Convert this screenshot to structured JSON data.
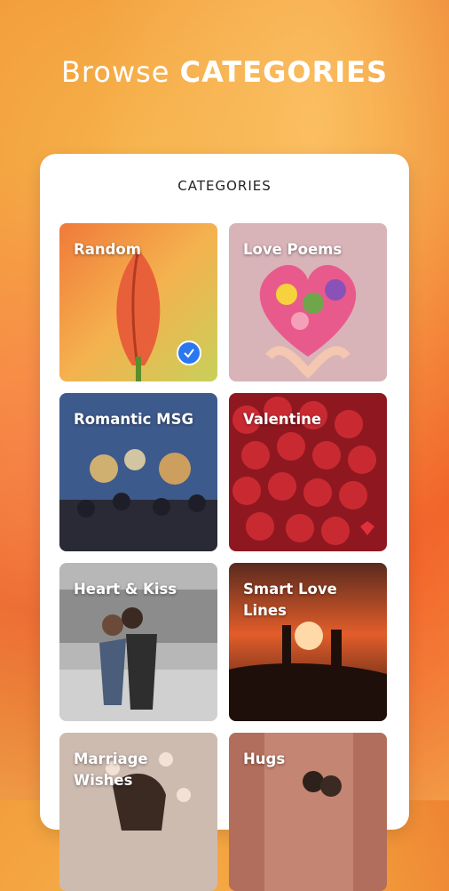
{
  "header": {
    "browse": "Browse",
    "categories": "CATEGORIES"
  },
  "panel": {
    "title": "CATEGORIES"
  },
  "categories": [
    {
      "label": "Random",
      "selected": true
    },
    {
      "label": "Love Poems",
      "selected": false
    },
    {
      "label": "Romantic MSG",
      "selected": false
    },
    {
      "label": "Valentine",
      "selected": false
    },
    {
      "label": "Heart & Kiss",
      "selected": false
    },
    {
      "label": "Smart Love Lines",
      "selected": false
    },
    {
      "label": "Marriage Wishes",
      "selected": false
    },
    {
      "label": "Hugs",
      "selected": false
    }
  ],
  "colors": {
    "accent": "#2b77f0",
    "headline": "#ffffff",
    "card": "#ffffff"
  }
}
